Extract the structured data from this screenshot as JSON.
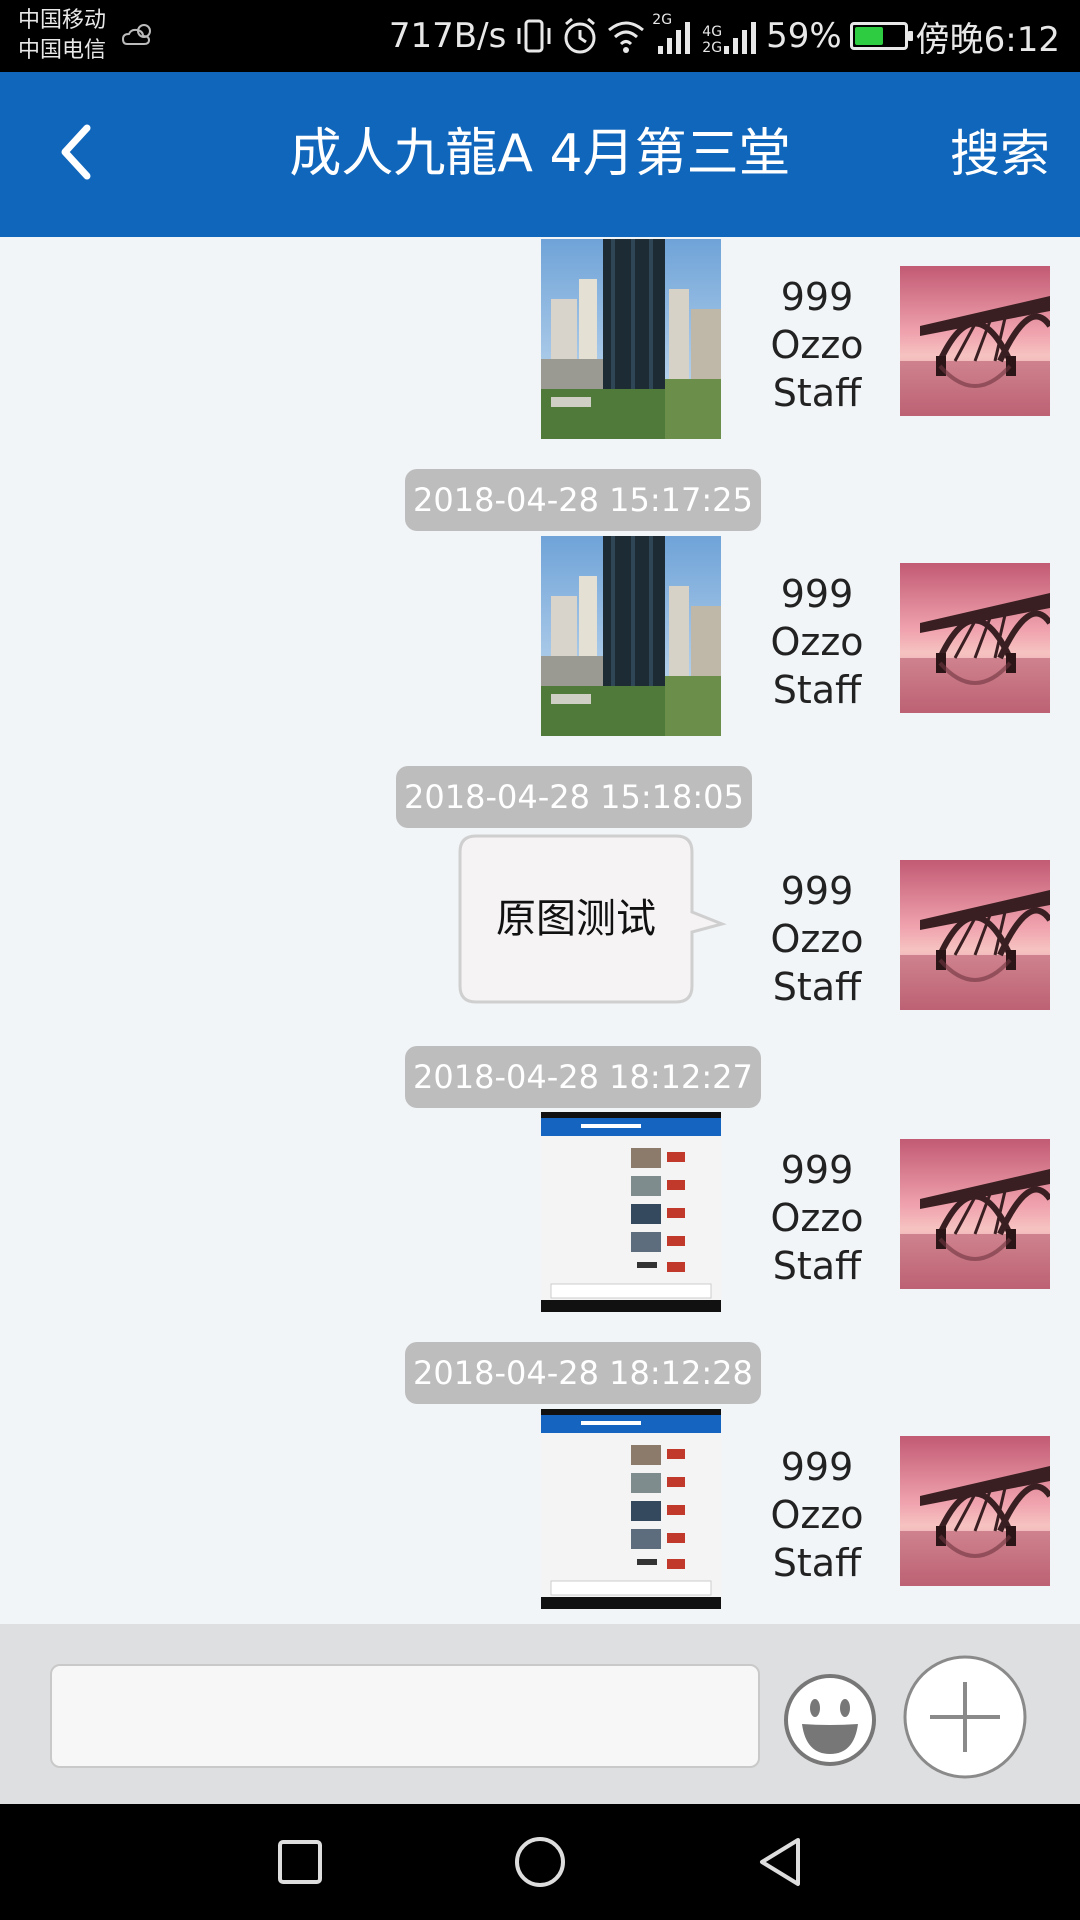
{
  "status_bar": {
    "carrier_1": "中国移动",
    "carrier_2": "中国电信",
    "net_speed": "717B/s",
    "net_2g": "2G",
    "net_4g": "4G",
    "net_4g_2g": "2G",
    "battery_percent": "59%",
    "battery_level": 0.59,
    "time": "傍晚6:12"
  },
  "header": {
    "title": "成人九龍A 4月第三堂",
    "search_label": "搜索",
    "background": "#0f66bb"
  },
  "sender": {
    "line1": "999",
    "line2": "Ozzo",
    "line3": "Staff"
  },
  "messages": [
    {
      "type": "image",
      "content": "city-buildings-photo"
    },
    {
      "type": "image",
      "timestamp": "2018-04-28 15:17:25",
      "content": "city-buildings-photo"
    },
    {
      "type": "text",
      "timestamp": "2018-04-28 15:18:05",
      "text": "原图测试"
    },
    {
      "type": "image",
      "timestamp": "2018-04-28 18:12:27",
      "content": "app-screenshot"
    },
    {
      "type": "image",
      "timestamp": "2018-04-28 18:12:28",
      "content": "app-screenshot"
    }
  ],
  "input": {
    "placeholder": "",
    "value": ""
  },
  "icons": {
    "back": "chevron-left-icon",
    "emoji": "smiley-icon",
    "plus": "plus-icon",
    "nav_recent": "square-icon",
    "nav_home": "circle-icon",
    "nav_back": "triangle-left-icon"
  },
  "colors": {
    "accent": "#0f66bb",
    "chat_bg": "#f1f5f8",
    "timestamp_bg": "#bdbdbd"
  }
}
